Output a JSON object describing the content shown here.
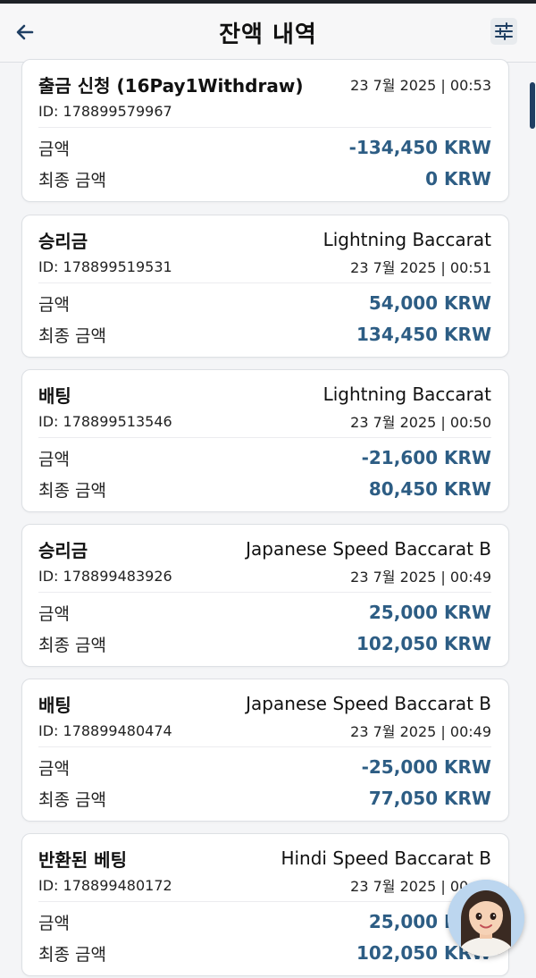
{
  "header": {
    "title": "잔액 내역",
    "back_icon": "arrow-left-icon",
    "filter_icon": "sliders-icon"
  },
  "labels": {
    "amount": "금액",
    "final_amount": "최종 금액"
  },
  "colors": {
    "amount": "#2d5d84",
    "scroll_thumb": "#1f3f63"
  },
  "transactions": [
    {
      "type": "출금 신청 (16Pay1Withdraw)",
      "game": "",
      "id": "ID: 178899579967",
      "date": "23 7월 2025 | 00:53",
      "amount": "-134,450 KRW",
      "final_amount": "0 KRW"
    },
    {
      "type": "승리금",
      "game": "Lightning Baccarat",
      "id": "ID: 178899519531",
      "date": "23 7월 2025 | 00:51",
      "amount": "54,000 KRW",
      "final_amount": "134,450 KRW"
    },
    {
      "type": "배팅",
      "game": "Lightning Baccarat",
      "id": "ID: 178899513546",
      "date": "23 7월 2025 | 00:50",
      "amount": "-21,600 KRW",
      "final_amount": "80,450 KRW"
    },
    {
      "type": "승리금",
      "game": "Japanese Speed Baccarat B",
      "id": "ID: 178899483926",
      "date": "23 7월 2025 | 00:49",
      "amount": "25,000 KRW",
      "final_amount": "102,050 KRW"
    },
    {
      "type": "배팅",
      "game": "Japanese Speed Baccarat B",
      "id": "ID: 178899480474",
      "date": "23 7월 2025 | 00:49",
      "amount": "-25,000 KRW",
      "final_amount": "77,050 KRW"
    },
    {
      "type": "반환된 베팅",
      "game": "Hindi Speed Baccarat B",
      "id": "ID: 178899480172",
      "date": "23 7월 2025 | 00:49",
      "amount": "25,000 KRW",
      "final_amount": "102,050 KRW"
    }
  ],
  "assistant": {
    "icon": "assistant-avatar-icon"
  }
}
